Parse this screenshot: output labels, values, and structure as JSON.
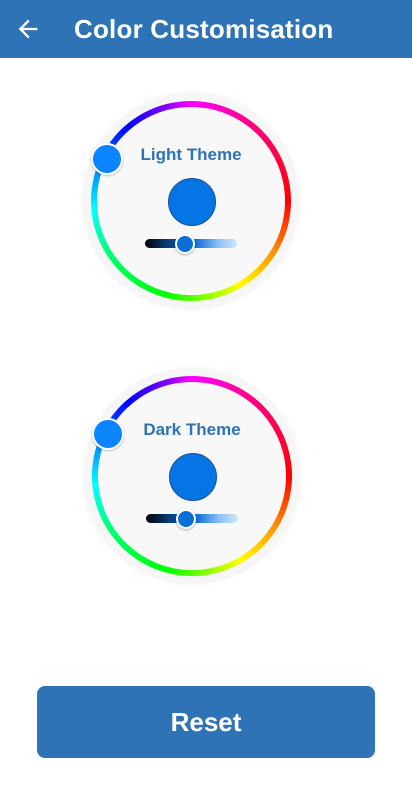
{
  "app_bar": {
    "title": "Color Customisation",
    "back_icon": "arrow-left-icon",
    "background": "#2E73B6"
  },
  "pickers": [
    {
      "label": "Light Theme",
      "selected_color": "#0575E6",
      "handle_color": "#0A84FF",
      "brightness": 0.44
    },
    {
      "label": "Dark Theme",
      "selected_color": "#0575E6",
      "handle_color": "#0A84FF",
      "brightness": 0.44
    }
  ],
  "actions": {
    "reset_label": "Reset"
  }
}
